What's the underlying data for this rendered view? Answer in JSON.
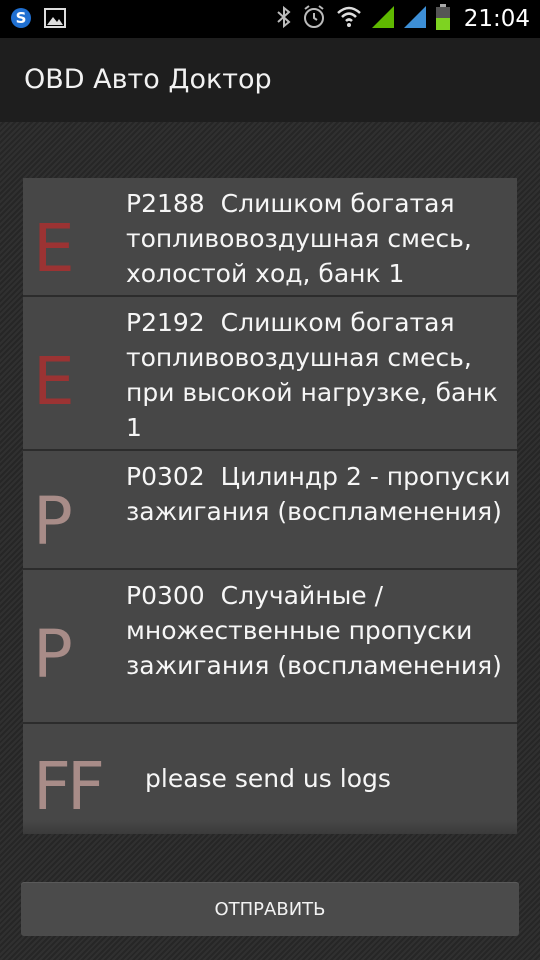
{
  "status_bar": {
    "time": "21:04",
    "icons": [
      "skype-icon",
      "image-notification-icon",
      "bluetooth-icon",
      "alarm-icon",
      "wifi-icon",
      "signal-icon",
      "signal-icon-2",
      "battery-icon"
    ],
    "signal_color": "#5fb800",
    "battery_color": "#7ed321"
  },
  "app_bar": {
    "title": "OBD Авто Доктор"
  },
  "trouble_codes": [
    {
      "icon": "E",
      "code": "P2188",
      "description": "Слишком богатая топливовоздушная смесь, холостой ход, банк 1"
    },
    {
      "icon": "E",
      "code": "P2192",
      "description": "Слишком богатая топливовоздушная смесь, при высокой нагрузке, банк 1"
    },
    {
      "icon": "P",
      "code": "P0302",
      "description": "Цилиндр 2 - пропуски зажигания (воспламенения)"
    },
    {
      "icon": "P",
      "code": "P0300",
      "description": "Случайные / множественные пропуски зажигания (воспламенения)"
    },
    {
      "icon": "FF",
      "code": "",
      "description": "please send us logs"
    }
  ],
  "actions": {
    "send_label": "ОТПРАВИТЬ"
  },
  "colors": {
    "error_icon": "#9b3333",
    "pending_icon": "#a88c88",
    "list_background": "#474747"
  }
}
